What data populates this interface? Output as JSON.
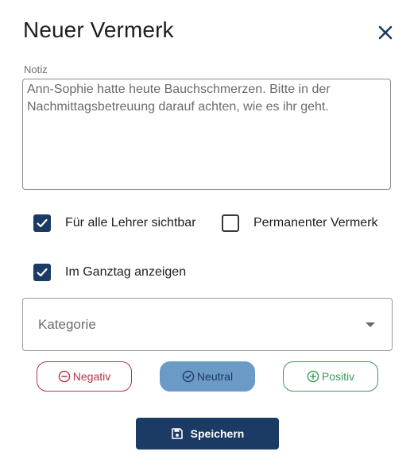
{
  "dialog": {
    "title": "Neuer Vermerk",
    "close_icon": "close-icon"
  },
  "note": {
    "label": "Notiz",
    "value": "Ann-Sophie hatte heute Bauchschmerzen. Bitte in der Nachmittagsbetreuung darauf achten, wie es ihr geht."
  },
  "options": {
    "all_teachers": {
      "label": "Für alle Lehrer sichtbar",
      "checked": true
    },
    "permanent": {
      "label": "Permanenter Vermerk",
      "checked": false
    },
    "ganztag": {
      "label": "Im Ganztag anzeigen",
      "checked": true
    }
  },
  "category": {
    "placeholder": "Kategorie",
    "icon": "dropdown-arrow-icon"
  },
  "sentiment": {
    "selected": "neutral",
    "negativ": {
      "label": "Negativ",
      "icon": "minus-circle-icon",
      "color": "#b2344a"
    },
    "neutral": {
      "label": "Neutral",
      "icon": "check-circle-icon",
      "color": "#6c9ac7"
    },
    "positiv": {
      "label": "Positiv",
      "icon": "plus-circle-icon",
      "color": "#3a9b5b"
    }
  },
  "actions": {
    "save_label": "Speichern",
    "save_icon": "save-icon"
  },
  "colors": {
    "primary": "#1b3a64",
    "text": "#1d1d1f",
    "muted": "#6b6b6b"
  }
}
